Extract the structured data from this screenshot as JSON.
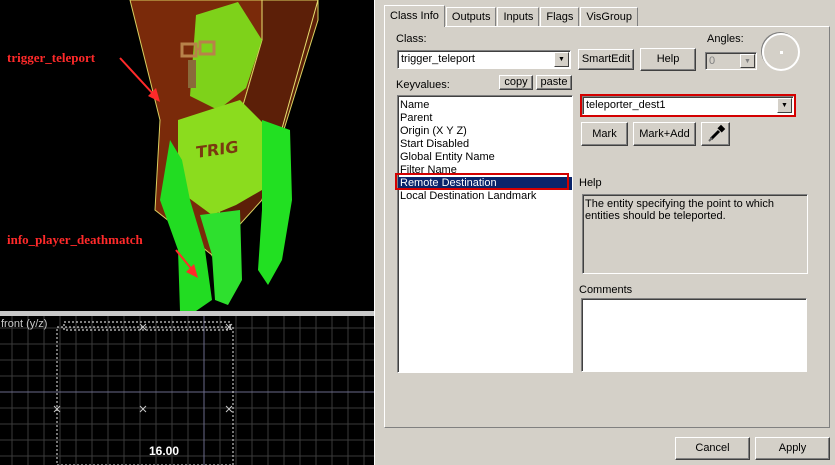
{
  "viewport3d": {
    "annotations": {
      "trigger": "trigger_teleport",
      "player": "info_player_deathmatch"
    },
    "crate_text": "TRIG"
  },
  "view2d": {
    "label": "front (y/z)",
    "size": "16.00"
  },
  "tabs": [
    "Class Info",
    "Outputs",
    "Inputs",
    "Flags",
    "VisGroup"
  ],
  "classinfo": {
    "class_label": "Class:",
    "class_value": "trigger_teleport",
    "smartedit_label": "SmartEdit",
    "help_button": "Help",
    "angles_label": "Angles:",
    "angles_value": "0",
    "keyvalues_label": "Keyvalues:",
    "copy_button": "copy",
    "paste_button": "paste",
    "keyvalues": [
      "Name",
      "Parent",
      "Origin (X Y Z)",
      "Start Disabled",
      "Global Entity Name",
      "Filter Name",
      "Remote Destination",
      "Local Destination Landmark"
    ],
    "selected_keyvalue": "Remote Destination",
    "value_field": "teleporter_dest1",
    "mark_button": "Mark",
    "markadd_button": "Mark+Add",
    "help_label": "Help",
    "help_text": "The entity specifying the point to which entities should be teleported.",
    "comments_label": "Comments",
    "comments_text": ""
  },
  "footer": {
    "cancel": "Cancel",
    "apply": "Apply"
  },
  "colors": {
    "highlight": "#d40000",
    "selection": "#0a246a",
    "annotation": "#ff2a2a"
  }
}
